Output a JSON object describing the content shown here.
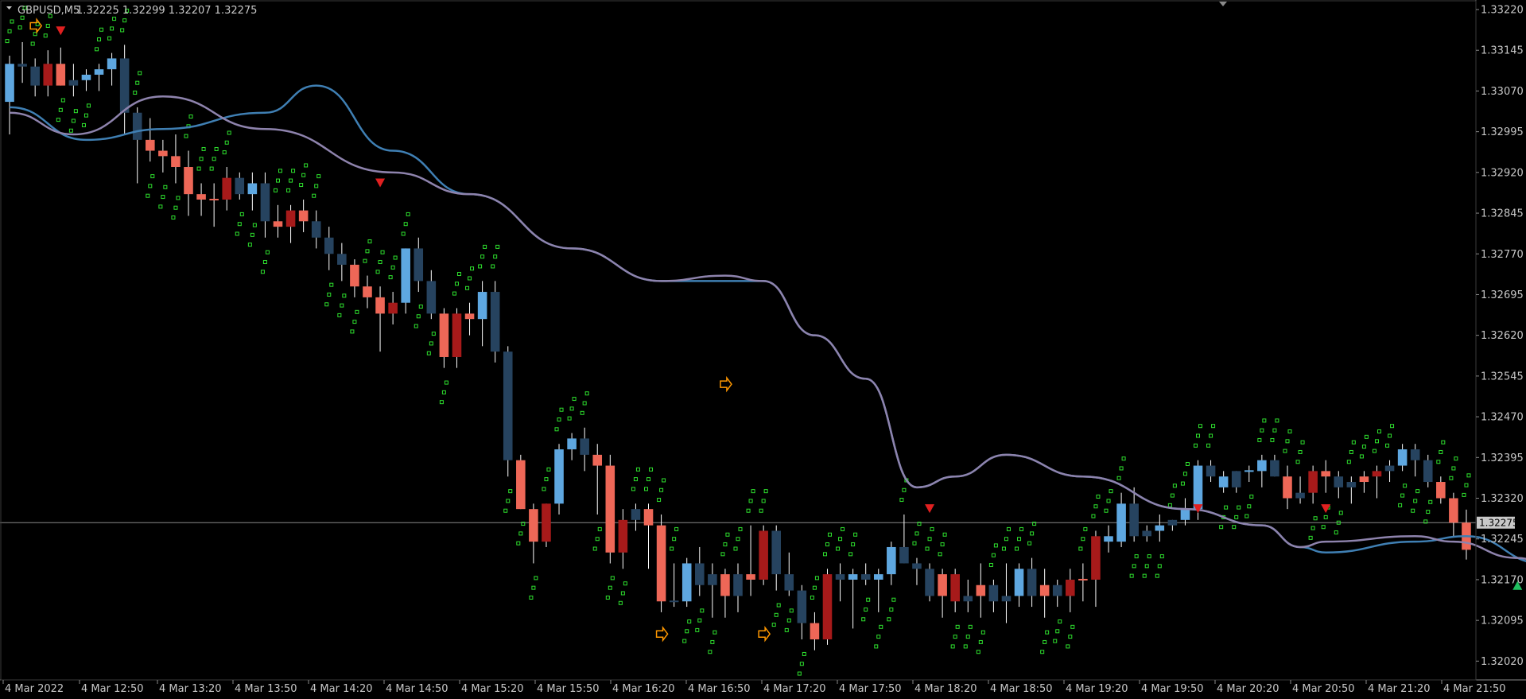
{
  "header": {
    "symbol_timeframe": "GBPUSD,M5",
    "ohlc": "1.32225 1.32299 1.32207 1.32275"
  },
  "colors": {
    "background": "#000000",
    "axis": "#8a8a8a",
    "text": "#c8c8c8",
    "bull_light": "#5ea7e0",
    "bull_dark": "#26435f",
    "bear_light": "#ee6757",
    "bear_dark": "#a71a1a",
    "wick": "#ffffff",
    "dots": "#2ee02e",
    "ma_upper": "#8e83ad",
    "ma_lower": "#3f7fb3",
    "sell_arrow": "#e02020",
    "buy_arrow": "#20c060",
    "signal": "#ff9800",
    "current_price_bg": "#c8c8c8"
  },
  "current_price": "1.32275",
  "chart_data": {
    "type": "candlestick",
    "title": "GBPUSD,M5",
    "ylim": [
      1.32,
      1.3322
    ],
    "y_ticks": [
      "1.33220",
      "1.33145",
      "1.33070",
      "1.32995",
      "1.32920",
      "1.32845",
      "1.32770",
      "1.32695",
      "1.32620",
      "1.32545",
      "1.32470",
      "1.32395",
      "1.32320",
      "1.32245",
      "1.32170",
      "1.32095",
      "1.32020"
    ],
    "x_labels": [
      "4 Mar 2022",
      "4 Mar 12:50",
      "4 Mar 13:20",
      "4 Mar 13:50",
      "4 Mar 14:20",
      "4 Mar 14:50",
      "4 Mar 15:20",
      "4 Mar 15:50",
      "4 Mar 16:20",
      "4 Mar 16:50",
      "4 Mar 17:20",
      "4 Mar 17:50",
      "4 Mar 18:20",
      "4 Mar 18:50",
      "4 Mar 19:20",
      "4 Mar 19:50",
      "4 Mar 20:20",
      "4 Mar 20:50",
      "4 Mar 21:20",
      "4 Mar 21:50"
    ],
    "candles": [
      [
        1.3305,
        1.33135,
        1.3299,
        1.3312,
        "l"
      ],
      [
        1.3312,
        1.3316,
        1.33085,
        1.33115,
        "d"
      ],
      [
        1.33115,
        1.3313,
        1.3306,
        1.3308,
        "d"
      ],
      [
        1.3308,
        1.33145,
        1.3306,
        1.3312,
        "r"
      ],
      [
        1.3312,
        1.3315,
        1.3308,
        1.3308,
        "o"
      ],
      [
        1.3308,
        1.3312,
        1.3306,
        1.3309,
        "d"
      ],
      [
        1.3309,
        1.3311,
        1.3307,
        1.331,
        "l"
      ],
      [
        1.331,
        1.3312,
        1.3307,
        1.3311,
        "l"
      ],
      [
        1.3311,
        1.3314,
        1.3308,
        1.3313,
        "l"
      ],
      [
        1.3313,
        1.33155,
        1.3299,
        1.3303,
        "d"
      ],
      [
        1.3303,
        1.3304,
        1.329,
        1.3298,
        "d"
      ],
      [
        1.3298,
        1.3302,
        1.3294,
        1.3296,
        "o"
      ],
      [
        1.3296,
        1.3298,
        1.3292,
        1.3295,
        "o"
      ],
      [
        1.3295,
        1.3299,
        1.329,
        1.3293,
        "o"
      ],
      [
        1.3293,
        1.3296,
        1.3284,
        1.3288,
        "o"
      ],
      [
        1.3288,
        1.329,
        1.3284,
        1.3287,
        "o"
      ],
      [
        1.3287,
        1.329,
        1.3282,
        1.3287,
        "o"
      ],
      [
        1.3287,
        1.3293,
        1.3285,
        1.3291,
        "r"
      ],
      [
        1.3291,
        1.3292,
        1.3287,
        1.3288,
        "d"
      ],
      [
        1.3288,
        1.3292,
        1.3285,
        1.329,
        "l"
      ],
      [
        1.329,
        1.3292,
        1.328,
        1.3283,
        "d"
      ],
      [
        1.3283,
        1.3286,
        1.328,
        1.3282,
        "o"
      ],
      [
        1.3282,
        1.3286,
        1.3279,
        1.3285,
        "r"
      ],
      [
        1.3285,
        1.3287,
        1.3281,
        1.3283,
        "o"
      ],
      [
        1.3283,
        1.3285,
        1.3278,
        1.328,
        "d"
      ],
      [
        1.328,
        1.3282,
        1.3274,
        1.3277,
        "d"
      ],
      [
        1.3277,
        1.3279,
        1.3272,
        1.3275,
        "d"
      ],
      [
        1.3275,
        1.3276,
        1.3269,
        1.3271,
        "o"
      ],
      [
        1.3271,
        1.3273,
        1.3267,
        1.3269,
        "o"
      ],
      [
        1.3269,
        1.3271,
        1.3259,
        1.3266,
        "o"
      ],
      [
        1.3266,
        1.327,
        1.3264,
        1.3268,
        "r"
      ],
      [
        1.3268,
        1.3278,
        1.3266,
        1.3278,
        "l"
      ],
      [
        1.3278,
        1.328,
        1.327,
        1.3272,
        "d"
      ],
      [
        1.3272,
        1.3274,
        1.3265,
        1.3266,
        "d"
      ],
      [
        1.3266,
        1.3267,
        1.3256,
        1.3258,
        "o"
      ],
      [
        1.3258,
        1.3267,
        1.3256,
        1.3266,
        "r"
      ],
      [
        1.3266,
        1.3268,
        1.3262,
        1.3265,
        "o"
      ],
      [
        1.3265,
        1.3272,
        1.326,
        1.327,
        "l"
      ],
      [
        1.327,
        1.3272,
        1.3257,
        1.3259,
        "d"
      ],
      [
        1.3259,
        1.326,
        1.3236,
        1.3239,
        "d"
      ],
      [
        1.3239,
        1.324,
        1.323,
        1.323,
        "o"
      ],
      [
        1.323,
        1.3231,
        1.322,
        1.3224,
        "o"
      ],
      [
        1.3224,
        1.3231,
        1.3223,
        1.3231,
        "r"
      ],
      [
        1.3231,
        1.3242,
        1.3229,
        1.3241,
        "l"
      ],
      [
        1.3241,
        1.3244,
        1.3239,
        1.3243,
        "l"
      ],
      [
        1.3243,
        1.3245,
        1.3237,
        1.324,
        "d"
      ],
      [
        1.324,
        1.3242,
        1.3229,
        1.3238,
        "o"
      ],
      [
        1.3238,
        1.324,
        1.322,
        1.3222,
        "o"
      ],
      [
        1.3222,
        1.323,
        1.3219,
        1.3228,
        "r"
      ],
      [
        1.3228,
        1.3231,
        1.3226,
        1.323,
        "d"
      ],
      [
        1.323,
        1.3231,
        1.3219,
        1.3227,
        "o"
      ],
      [
        1.3227,
        1.3229,
        1.3211,
        1.3213,
        "o"
      ],
      [
        1.3213,
        1.322,
        1.3212,
        1.3213,
        "d"
      ],
      [
        1.3213,
        1.3221,
        1.3212,
        1.322,
        "l"
      ],
      [
        1.322,
        1.3223,
        1.3214,
        1.3216,
        "d"
      ],
      [
        1.3216,
        1.322,
        1.321,
        1.3218,
        "d"
      ],
      [
        1.3218,
        1.3219,
        1.321,
        1.3214,
        "o"
      ],
      [
        1.3214,
        1.322,
        1.3211,
        1.3218,
        "d"
      ],
      [
        1.3218,
        1.3227,
        1.3214,
        1.3217,
        "o"
      ],
      [
        1.3217,
        1.3227,
        1.3216,
        1.3226,
        "r"
      ],
      [
        1.3226,
        1.3227,
        1.3215,
        1.3218,
        "d"
      ],
      [
        1.3218,
        1.3222,
        1.3214,
        1.3215,
        "d"
      ],
      [
        1.3215,
        1.3216,
        1.3206,
        1.3209,
        "d"
      ],
      [
        1.3209,
        1.3211,
        1.3204,
        1.3206,
        "o"
      ],
      [
        1.3206,
        1.3219,
        1.3205,
        1.3218,
        "r"
      ],
      [
        1.3218,
        1.322,
        1.3213,
        1.3217,
        "d"
      ],
      [
        1.3217,
        1.3219,
        1.3208,
        1.3218,
        "l"
      ],
      [
        1.3218,
        1.322,
        1.3216,
        1.3217,
        "d"
      ],
      [
        1.3217,
        1.3219,
        1.3211,
        1.3218,
        "l"
      ],
      [
        1.3218,
        1.3224,
        1.3216,
        1.3223,
        "l"
      ],
      [
        1.3223,
        1.3229,
        1.322,
        1.322,
        "d"
      ],
      [
        1.322,
        1.3221,
        1.3216,
        1.3219,
        "d"
      ],
      [
        1.3219,
        1.322,
        1.3213,
        1.3214,
        "d"
      ],
      [
        1.3214,
        1.3219,
        1.321,
        1.3218,
        "o"
      ],
      [
        1.3218,
        1.3219,
        1.3211,
        1.3213,
        "r"
      ],
      [
        1.3213,
        1.3217,
        1.3211,
        1.3214,
        "d"
      ],
      [
        1.3214,
        1.322,
        1.321,
        1.3216,
        "o"
      ],
      [
        1.3216,
        1.3217,
        1.3211,
        1.3213,
        "d"
      ],
      [
        1.3213,
        1.322,
        1.3209,
        1.3214,
        "d"
      ],
      [
        1.3214,
        1.322,
        1.3212,
        1.3219,
        "l"
      ],
      [
        1.3219,
        1.3221,
        1.3212,
        1.3214,
        "d"
      ],
      [
        1.3214,
        1.3219,
        1.321,
        1.3216,
        "o"
      ],
      [
        1.3216,
        1.3217,
        1.3212,
        1.3214,
        "d"
      ],
      [
        1.3214,
        1.3219,
        1.3211,
        1.3217,
        "r"
      ],
      [
        1.3217,
        1.322,
        1.3213,
        1.3217,
        "o"
      ],
      [
        1.3217,
        1.3226,
        1.3212,
        1.3225,
        "r"
      ],
      [
        1.3225,
        1.3227,
        1.3222,
        1.3224,
        "l"
      ],
      [
        1.3224,
        1.3233,
        1.3223,
        1.3231,
        "l"
      ],
      [
        1.3231,
        1.3234,
        1.3224,
        1.3225,
        "d"
      ],
      [
        1.3225,
        1.3227,
        1.3224,
        1.3226,
        "d"
      ],
      [
        1.3226,
        1.3229,
        1.3224,
        1.3227,
        "l"
      ],
      [
        1.3227,
        1.3228,
        1.3226,
        1.3228,
        "d"
      ],
      [
        1.3228,
        1.3232,
        1.3227,
        1.323,
        "l"
      ],
      [
        1.323,
        1.3239,
        1.3228,
        1.3238,
        "l"
      ],
      [
        1.3238,
        1.3239,
        1.3235,
        1.3236,
        "d"
      ],
      [
        1.3236,
        1.3237,
        1.3233,
        1.3234,
        "l"
      ],
      [
        1.3234,
        1.3237,
        1.3233,
        1.3237,
        "d"
      ],
      [
        1.3237,
        1.3238,
        1.3235,
        1.3237,
        "l"
      ],
      [
        1.3237,
        1.324,
        1.3234,
        1.3239,
        "l"
      ],
      [
        1.3239,
        1.324,
        1.3236,
        1.3236,
        "d"
      ],
      [
        1.3236,
        1.3238,
        1.323,
        1.3232,
        "o"
      ],
      [
        1.3232,
        1.3236,
        1.3231,
        1.3233,
        "d"
      ],
      [
        1.3233,
        1.3238,
        1.3231,
        1.3237,
        "r"
      ],
      [
        1.3237,
        1.3239,
        1.3233,
        1.3236,
        "o"
      ],
      [
        1.3236,
        1.3237,
        1.3232,
        1.3234,
        "d"
      ],
      [
        1.3234,
        1.3236,
        1.3231,
        1.3235,
        "d"
      ],
      [
        1.3235,
        1.3237,
        1.3233,
        1.3236,
        "o"
      ],
      [
        1.3236,
        1.3238,
        1.3232,
        1.3237,
        "r"
      ],
      [
        1.3237,
        1.3239,
        1.3235,
        1.3238,
        "d"
      ],
      [
        1.3238,
        1.3242,
        1.3237,
        1.3241,
        "l"
      ],
      [
        1.3241,
        1.3242,
        1.3236,
        1.3239,
        "d"
      ],
      [
        1.3239,
        1.324,
        1.3234,
        1.3235,
        "d"
      ],
      [
        1.3235,
        1.3236,
        1.3231,
        1.3232,
        "o"
      ],
      [
        1.3232,
        1.3233,
        1.3225,
        1.32275,
        "o"
      ],
      [
        1.32275,
        1.32299,
        1.32207,
        1.32225,
        "o"
      ]
    ],
    "ma_upper_points": [
      [
        1.3303,
        0
      ],
      [
        1.3299,
        5
      ],
      [
        1.3306,
        12
      ],
      [
        1.33,
        20
      ],
      [
        1.3292,
        30
      ],
      [
        1.3288,
        36
      ],
      [
        1.3278,
        44
      ],
      [
        1.3272,
        51
      ],
      [
        1.3273,
        56
      ],
      [
        1.3272,
        59
      ],
      [
        1.3262,
        63
      ],
      [
        1.3254,
        67
      ],
      [
        1.3234,
        71
      ],
      [
        1.3236,
        74
      ],
      [
        1.324,
        78
      ],
      [
        1.3236,
        84
      ],
      [
        1.323,
        92
      ],
      [
        1.3227,
        98
      ],
      [
        1.3223,
        101
      ],
      [
        1.3224,
        103
      ],
      [
        1.3225,
        110
      ],
      [
        1.3224,
        113
      ],
      [
        1.3221,
        118
      ],
      [
        1.3219,
        121
      ]
    ],
    "ma_lower_points": [
      [
        1.3304,
        0
      ],
      [
        1.3298,
        6
      ],
      [
        1.33,
        12
      ],
      [
        1.3303,
        20
      ],
      [
        1.3308,
        24
      ],
      [
        1.3296,
        30
      ],
      [
        1.3288,
        36
      ],
      [
        1.3278,
        44
      ],
      [
        1.3272,
        51
      ],
      [
        1.3272,
        56
      ],
      [
        1.3272,
        59
      ],
      [
        1.3262,
        63
      ],
      [
        1.3254,
        67
      ],
      [
        1.3234,
        71
      ],
      [
        1.3236,
        74
      ],
      [
        1.324,
        78
      ],
      [
        1.3236,
        84
      ],
      [
        1.323,
        92
      ],
      [
        1.3227,
        98
      ],
      [
        1.3223,
        101
      ],
      [
        1.3222,
        103
      ],
      [
        1.3224,
        110
      ],
      [
        1.3225,
        114
      ],
      [
        1.322,
        120
      ]
    ]
  }
}
